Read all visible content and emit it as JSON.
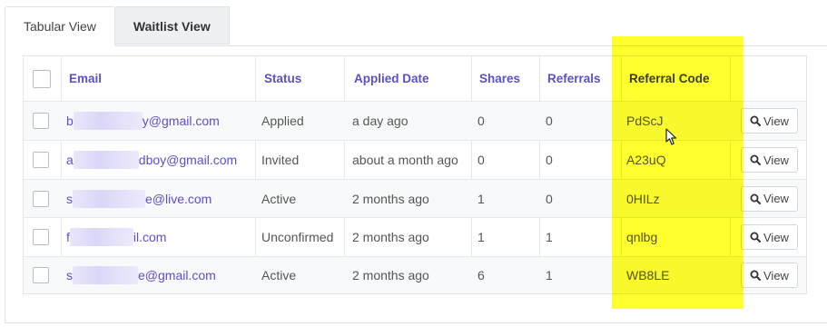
{
  "tabs": [
    {
      "label": "Tabular View",
      "active": true
    },
    {
      "label": "Waitlist View",
      "active": false
    }
  ],
  "table": {
    "headers": {
      "email": "Email",
      "status": "Status",
      "applied_date": "Applied Date",
      "shares": "Shares",
      "referrals": "Referrals",
      "referral_code": "Referral Code"
    },
    "rows": [
      {
        "email_start": "b",
        "email_end": "y@gmail.com",
        "status": "Applied",
        "applied": "a day ago",
        "shares": "0",
        "referrals": "0",
        "code": "PdScJ",
        "view": "View"
      },
      {
        "email_start": "a",
        "email_end": "dboy@gmail.com",
        "status": "Invited",
        "applied": "about a month ago",
        "shares": "0",
        "referrals": "0",
        "code": "A23uQ",
        "view": "View"
      },
      {
        "email_start": "s",
        "email_end": "e@live.com",
        "status": "Active",
        "applied": "2 months ago",
        "shares": "1",
        "referrals": "0",
        "code": "0HILz",
        "view": "View"
      },
      {
        "email_start": "f",
        "email_end": "il.com",
        "status": "Unconfirmed",
        "applied": "2 months ago",
        "shares": "1",
        "referrals": "1",
        "code": "qnlbg",
        "view": "View"
      },
      {
        "email_start": "s",
        "email_end": "e@gmail.com",
        "status": "Active",
        "applied": "2 months ago",
        "shares": "6",
        "referrals": "1",
        "code": "WB8LE",
        "view": "View"
      }
    ]
  },
  "colors": {
    "link": "#5a4fcf",
    "highlight": "#ffff00"
  },
  "icons": {
    "view": "search-icon"
  }
}
